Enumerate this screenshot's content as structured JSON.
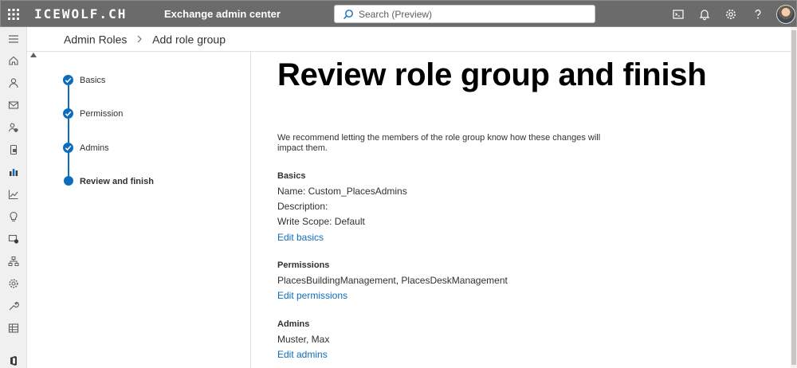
{
  "header": {
    "brand": "ICEWOLF.CH",
    "app_name": "Exchange admin center",
    "search_placeholder": "Search (Preview)",
    "colors": {
      "bar": "#6b6b6b",
      "accent": "#0f6cbd"
    }
  },
  "left_nav": {
    "icons": [
      "menu-icon",
      "home-icon",
      "person-icon",
      "mail-icon",
      "user-shield-icon",
      "mobile-icon",
      "reports-icon",
      "chart-icon",
      "lightbulb-icon",
      "migration-icon",
      "org-icon",
      "gear-icon",
      "wrench-icon",
      "table-icon",
      "office-icon"
    ]
  },
  "breadcrumb": {
    "root": "Admin Roles",
    "current": "Add role group"
  },
  "wizard": {
    "steps": [
      {
        "label": "Basics",
        "state": "done"
      },
      {
        "label": "Permission",
        "state": "done"
      },
      {
        "label": "Admins",
        "state": "done"
      },
      {
        "label": "Review and finish",
        "state": "current"
      }
    ]
  },
  "review": {
    "title": "Review role group and finish",
    "intro": "We recommend letting the members of the role group know how these changes will impact them.",
    "basics": {
      "heading": "Basics",
      "name": "Name: Custom_PlacesAdmins",
      "description": "Description:",
      "write_scope": "Write Scope: Default",
      "edit_link": "Edit basics"
    },
    "permissions": {
      "heading": "Permissions",
      "value": "PlacesBuildingManagement, PlacesDeskManagement",
      "edit_link": "Edit permissions"
    },
    "admins": {
      "heading": "Admins",
      "value": "Muster, Max",
      "edit_link": "Edit admins"
    }
  }
}
